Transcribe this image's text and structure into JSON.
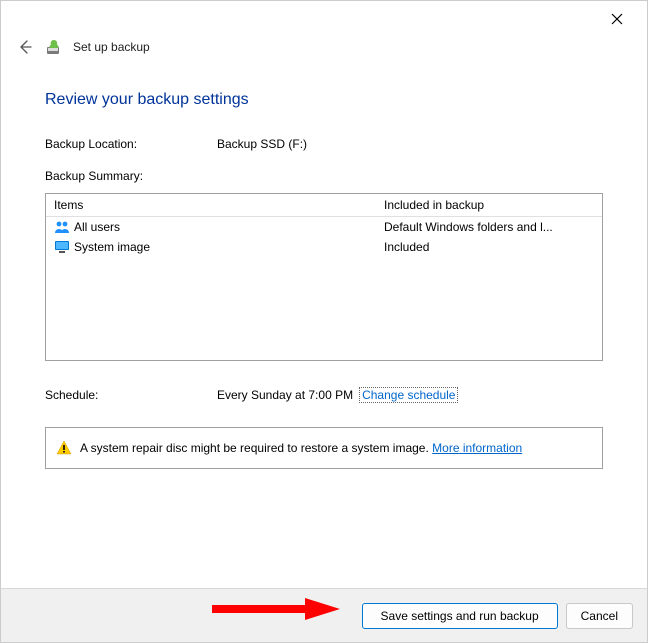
{
  "window": {
    "title": "Set up backup"
  },
  "heading": "Review your backup settings",
  "location": {
    "label": "Backup Location:",
    "value": "Backup SSD (F:)"
  },
  "summary": {
    "label": "Backup Summary:",
    "columns": {
      "c1": "Items",
      "c2": "Included in backup"
    },
    "rows": [
      {
        "item": "All users",
        "included": "Default Windows folders and l..."
      },
      {
        "item": "System image",
        "included": "Included"
      }
    ]
  },
  "schedule": {
    "label": "Schedule:",
    "value": "Every Sunday at 7:00 PM",
    "change_link": "Change schedule"
  },
  "notice": {
    "text": "A system repair disc might be required to restore a system image.",
    "link": "More information"
  },
  "footer": {
    "primary": "Save settings and run backup",
    "cancel": "Cancel"
  }
}
